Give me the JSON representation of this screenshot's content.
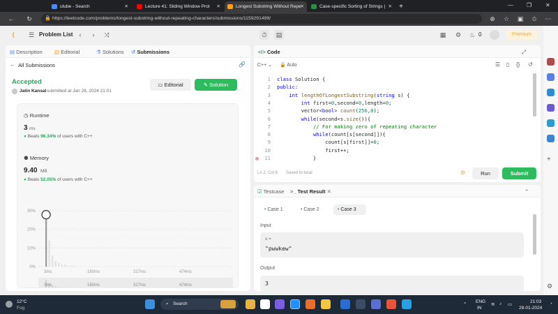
{
  "browser": {
    "tabs": [
      {
        "title": "utube - Search",
        "color": "#4b8bf5"
      },
      {
        "title": "Lecture 41: Sliding Window Prot",
        "color": "#ff0000"
      },
      {
        "title": "Longest Substring Without Repe",
        "color": "#ffa116"
      },
      {
        "title": "Case-specific Sorting of Strings |",
        "color": "#2f8d46"
      }
    ],
    "url": "https://leetcode.com/problems/longest-substring-without-repeating-characters/submissions/1159291499/"
  },
  "header": {
    "problem_list": "Problem List",
    "fire_count": "0",
    "premium": "Premium"
  },
  "left": {
    "tabs": [
      "Description",
      "Editorial",
      "Solutions",
      "Submissions"
    ],
    "all_submissions": "All Submissions",
    "status": "Accepted",
    "user": "Jatin Kansal",
    "submitted": "submitted at Jan 28, 2024 21:01",
    "editorial_btn": "Editorial",
    "solution_btn": "Solution",
    "runtime": {
      "label": "Runtime",
      "value": "3",
      "unit": "ms",
      "beats_prefix": "Beats",
      "beats": "96.34%",
      "beats_suffix": "of users with C++"
    },
    "memory": {
      "label": "Memory",
      "value": "9.40",
      "unit": "MB",
      "beats_prefix": "Beats",
      "beats": "52.05%",
      "beats_suffix": "of users with C++"
    }
  },
  "chart_data": {
    "type": "bar",
    "categories": [
      "3ms",
      "160ms",
      "317ms",
      "474ms"
    ],
    "yticks": [
      "30%",
      "20%",
      "10%",
      "0%"
    ],
    "ylim": [
      0,
      30
    ],
    "bars": [
      {
        "x": 0,
        "value": 26
      },
      {
        "x": 1,
        "value": 14
      },
      {
        "x": 2,
        "value": 6
      },
      {
        "x": 3,
        "value": 3
      },
      {
        "x": 4,
        "value": 2
      },
      {
        "x": 5,
        "value": 1
      },
      {
        "x": 6,
        "value": 1
      },
      {
        "x": 7,
        "value": 0.5
      },
      {
        "x": 8,
        "value": 0.5
      },
      {
        "x": 9,
        "value": 0.5
      }
    ],
    "selected_index": 0,
    "mini_categories": [
      "3ms",
      "160ms",
      "317ms",
      "474ms"
    ]
  },
  "code": {
    "title": "Code",
    "language": "C++",
    "mode": "Auto",
    "lines": [
      {
        "n": "1",
        "html": "<span class=\"kw\">class</span> Solution {"
      },
      {
        "n": "2",
        "html": "<span class=\"kw\">public</span>:"
      },
      {
        "n": "3",
        "html": "    <span class=\"kw\">int</span> <span class=\"fn\">lengthOfLongestSubstring</span>(<span class=\"kw\">string</span> s) {"
      },
      {
        "n": "4",
        "html": "        <span class=\"kw\">int</span> first=<span class=\"num\">0</span>,second=<span class=\"num\">0</span>,length=<span class=\"num\">0</span>;"
      },
      {
        "n": "5",
        "html": "        vector&lt;<span class=\"kw\">bool</span>&gt; <span class=\"fn\">count</span>(<span class=\"num\">256</span>,<span class=\"num\">0</span>);"
      },
      {
        "n": "6",
        "html": "        <span class=\"kw\">while</span>(second&lt;s.<span class=\"fn\">size</span>()){"
      },
      {
        "n": "7",
        "html": "            <span class=\"cm\">// For making zero of repeating character</span>"
      },
      {
        "n": "8",
        "html": "            <span class=\"kw\">while</span>(count[s[second]]){"
      },
      {
        "n": "9",
        "html": "                count[s[first]]=<span class=\"num\">0</span>;"
      },
      {
        "n": "10",
        "html": "                first++;"
      },
      {
        "n": "11",
        "html": "            }"
      }
    ],
    "cursor": "Ln 2, Col 8",
    "saved": "Saved to local",
    "run": "Run",
    "submit": "Submit"
  },
  "result": {
    "tabs": [
      "Testcase",
      "Test Result"
    ],
    "cases": [
      "Case 1",
      "Case 2",
      "Case 3"
    ],
    "input_label": "Input",
    "var": "s =",
    "input_value": "\"pwwkew\"",
    "output_label": "Output",
    "output_value": "3"
  },
  "taskbar": {
    "temp": "12°C",
    "weather": "Fog",
    "search": "Search",
    "lang1": "ENG",
    "lang2": "IN",
    "time": "21:03",
    "date": "28-01-2024"
  }
}
